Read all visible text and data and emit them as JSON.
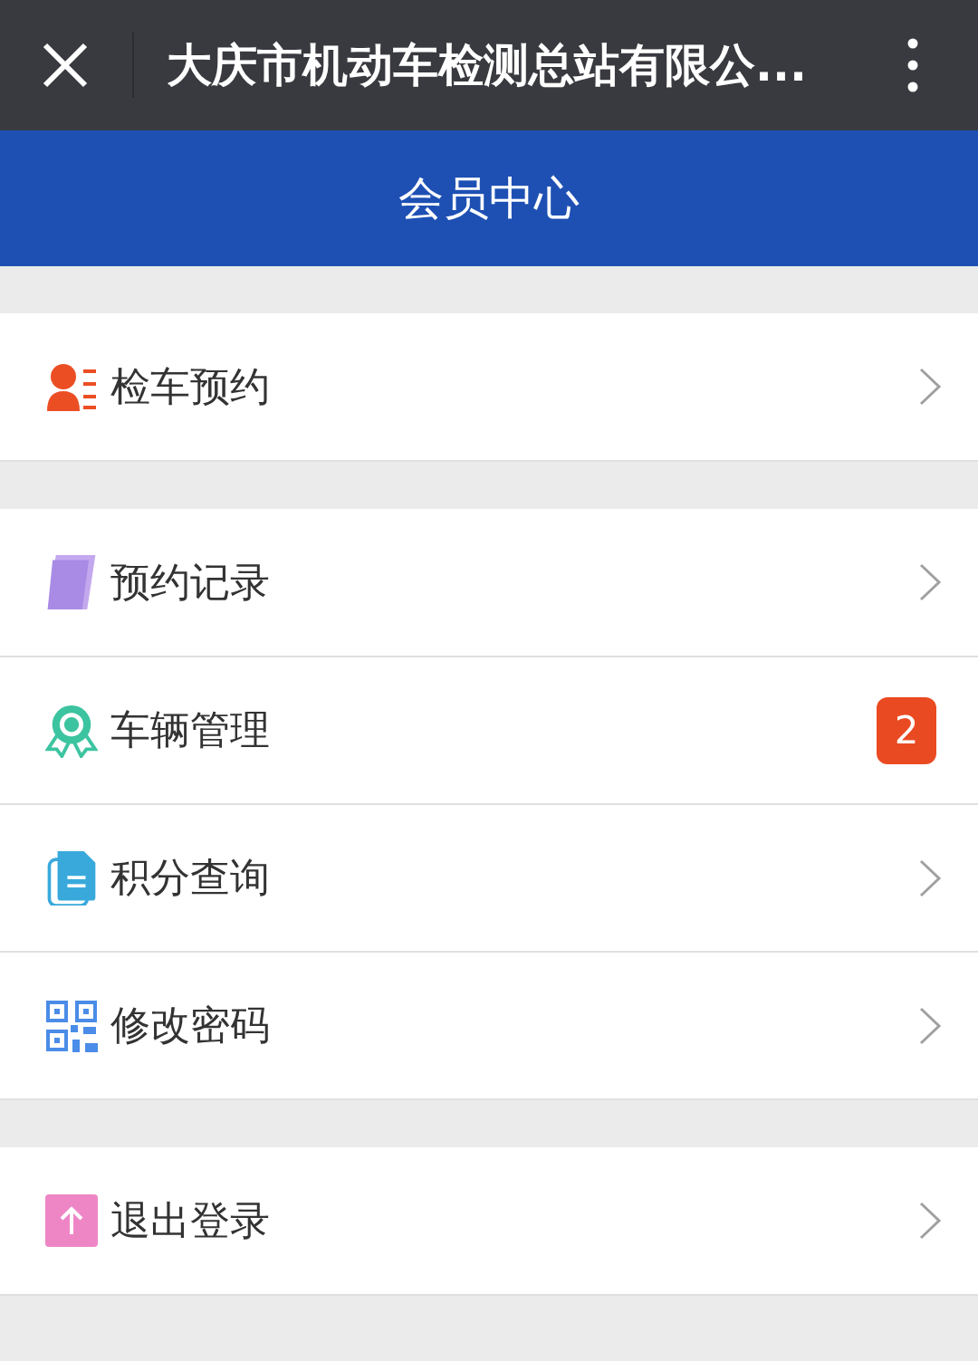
{
  "top_bar": {
    "title": "大庆市机动车检测总站有限公..."
  },
  "header": {
    "title": "会员中心"
  },
  "groups": [
    {
      "items": [
        {
          "label": "检车预约"
        }
      ]
    },
    {
      "items": [
        {
          "label": "预约记录"
        },
        {
          "label": "车辆管理",
          "badge": "2"
        },
        {
          "label": "积分查询"
        },
        {
          "label": "修改密码"
        }
      ]
    },
    {
      "items": [
        {
          "label": "退出登录"
        }
      ]
    }
  ]
}
